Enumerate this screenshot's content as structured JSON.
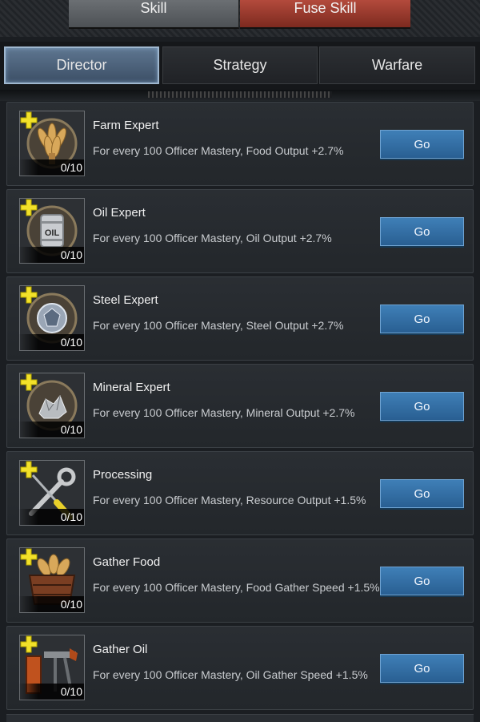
{
  "top_tabs": {
    "skill": "Skill",
    "fuse_skill": "Fuse Skill"
  },
  "sub_tabs": {
    "director": "Director",
    "strategy": "Strategy",
    "warfare": "Warfare"
  },
  "skills": [
    {
      "title": "Farm Expert",
      "desc": "For every 100 Officer Mastery, Food Output +2.7%",
      "level": "0/10",
      "button": "Go",
      "icon": "wheat-medal-icon"
    },
    {
      "title": "Oil Expert",
      "desc": "For every 100 Officer Mastery, Oil Output +2.7%",
      "level": "0/10",
      "button": "Go",
      "icon": "oil-barrel-medal-icon"
    },
    {
      "title": "Steel Expert",
      "desc": "For every 100 Officer Mastery, Steel Output +2.7%",
      "level": "0/10",
      "button": "Go",
      "icon": "steel-medal-icon"
    },
    {
      "title": "Mineral Expert",
      "desc": "For every 100 Officer Mastery, Mineral Output +2.7%",
      "level": "0/10",
      "button": "Go",
      "icon": "mineral-medal-icon"
    },
    {
      "title": "Processing",
      "desc": "For every 100 Officer Mastery, Resource Output +1.5%",
      "level": "0/10",
      "button": "Go",
      "icon": "wrench-screwdriver-icon"
    },
    {
      "title": "Gather Food",
      "desc": "For every 100 Officer Mastery, Food Gather Speed +1.5%",
      "level": "0/10",
      "button": "Go",
      "icon": "food-crate-icon"
    },
    {
      "title": "Gather Oil",
      "desc": "For every 100 Officer Mastery, Oil Gather Speed +1.5%",
      "level": "0/10",
      "button": "Go",
      "icon": "oil-pump-icon"
    }
  ]
}
